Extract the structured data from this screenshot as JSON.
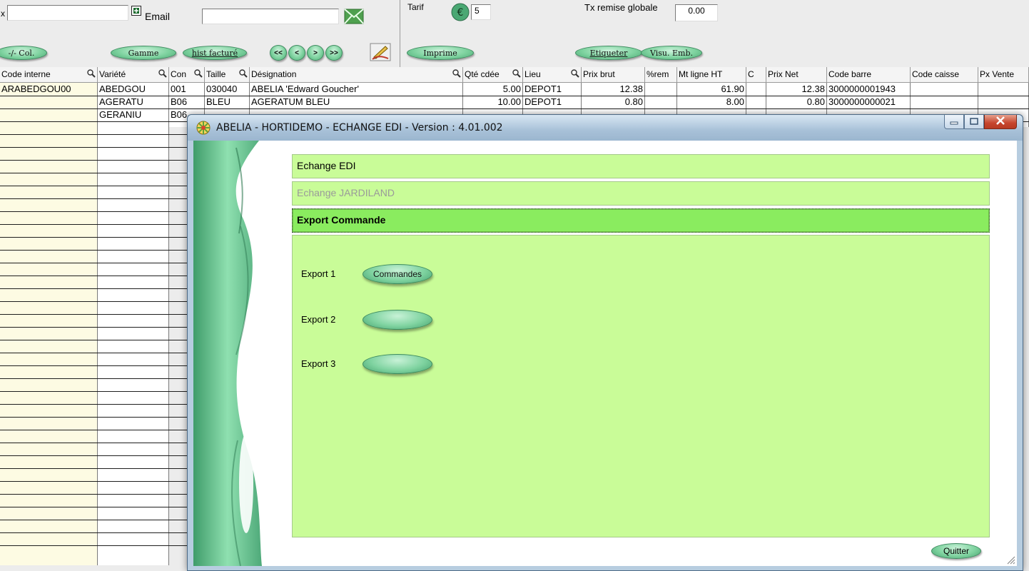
{
  "toolbar": {
    "left_field_label_fragment": "x",
    "left_field_value": "",
    "email_label": "Email",
    "email_value": "",
    "col_button": "-/- Col.",
    "gamme_button": "Gamme",
    "hist_button": "hist facturé",
    "nav_first": "<<",
    "nav_prev": "<",
    "nav_next": ">",
    "nav_last": ">>",
    "imprime_button": "Imprime",
    "tarif_label": "Tarif",
    "tarif_value": "5",
    "remise_label": "Tx remise globale",
    "remise_value": "0.00",
    "etiqueter_button": "Etiqueter",
    "visu_button": "Visu. Emb."
  },
  "grid": {
    "headers": [
      "Code interne",
      "Variété",
      "Con",
      "Taille",
      "Désignation",
      "Qté cdée",
      "Lieu",
      "Prix brut",
      "%rem",
      "Mt ligne HT",
      "C",
      "Prix Net",
      "Code barre",
      "Code caisse",
      "Px Vente"
    ],
    "rows": [
      [
        "ARABEDGOU00",
        "ABEDGOU",
        "001",
        "030040",
        "ABELIA 'Edward Goucher'",
        "5.00",
        "DEPOT1",
        "12.38",
        "",
        "61.90",
        "",
        "12.38",
        "3000000001943",
        "",
        ""
      ],
      [
        "",
        "AGERATU",
        "B06",
        "BLEU",
        "AGERATUM BLEU",
        "10.00",
        "DEPOT1",
        "0.80",
        "",
        "8.00",
        "",
        "0.80",
        "3000000000021",
        "",
        ""
      ],
      [
        "",
        "GERANIU",
        "B06",
        "",
        "",
        "",
        "",
        "",
        "",
        "",
        "",
        "",
        "",
        "",
        ""
      ]
    ]
  },
  "dialog": {
    "title": "ABELIA  -  HORTIDEMO  -  ECHANGE EDI  -  Version : 4.01.002",
    "section_edi": "Echange EDI",
    "section_jardiland": "Echange JARDILAND",
    "section_export": "Export Commande",
    "exports": [
      {
        "label": "Export 1",
        "button": "Commandes"
      },
      {
        "label": "Export 2",
        "button": ""
      },
      {
        "label": "Export 3",
        "button": ""
      }
    ],
    "quit_button": "Quitter"
  }
}
